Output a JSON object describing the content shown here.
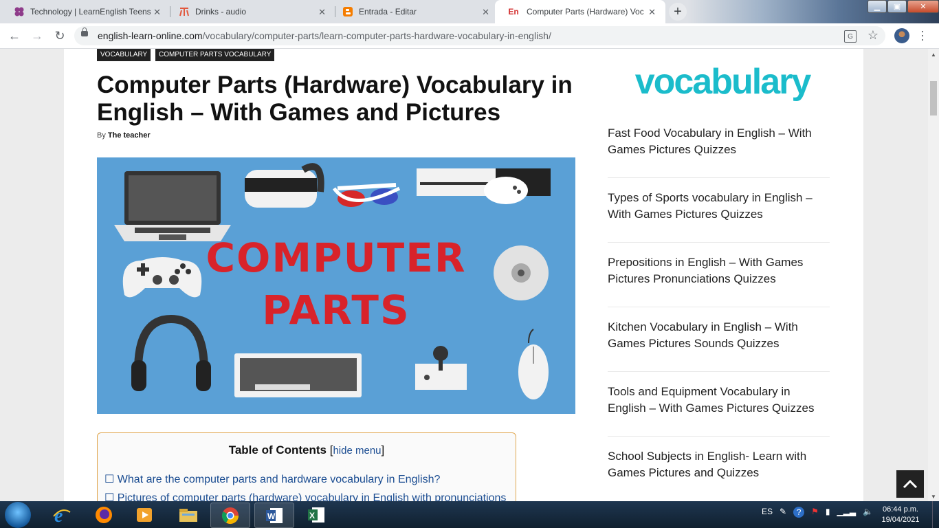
{
  "browser": {
    "tabs": [
      {
        "title": "Technology | LearnEnglish Teens",
        "icon": "four-petal-icon"
      },
      {
        "title": "Drinks - audio",
        "icon": "quill-icon"
      },
      {
        "title": "Entrada - Editar",
        "icon": "blogger-icon"
      },
      {
        "title": "Computer Parts (Hardware) Vocabulary",
        "icon": "en-icon",
        "icon_text": "En"
      }
    ],
    "new_tab": "+",
    "url_host": "english-learn-online.com",
    "url_path": "/vocabulary/computer-parts/learn-computer-parts-hardware-vocabulary-in-english/"
  },
  "article": {
    "categories": [
      "VOCABULARY",
      "COMPUTER PARTS VOCABULARY"
    ],
    "title": "Computer Parts (Hardware) Vocabulary in English – With Games and Pictures",
    "by_label": "By",
    "author": "The teacher",
    "hero_lines": [
      "COMPUTER",
      "PARTS"
    ],
    "toc": {
      "heading": "Table of Contents",
      "toggle": "hide menu",
      "items": [
        "☐ What are the computer parts and hardware vocabulary in English?",
        "☐ Pictures of computer parts (hardware) vocabulary in English with pronunciations"
      ]
    }
  },
  "sidebar": {
    "logo": "vocabulary",
    "links": [
      "Fast Food Vocabulary in English – With Games Pictures Quizzes",
      "Types of Sports vocabulary in English – With Games Pictures Quizzes",
      "Prepositions in English – With Games Pictures Pronunciations Quizzes",
      "Kitchen Vocabulary in English – With Games Pictures Sounds Quizzes",
      "Tools and Equipment Vocabulary in English – With Games Pictures Quizzes",
      "School Subjects in English- Learn with Games Pictures and Quizzes"
    ]
  },
  "taskbar": {
    "apps": [
      "internet-explorer-icon",
      "firefox-icon",
      "media-player-icon",
      "file-explorer-icon",
      "chrome-icon",
      "word-icon",
      "excel-icon"
    ],
    "lang": "ES",
    "time": "06:44 p.m.",
    "date": "19/04/2021"
  },
  "colors": {
    "accent": "#1bbccb",
    "hero_bg": "#5aa0d6",
    "link": "#1a4c91",
    "toc_border": "#e0a64d"
  }
}
